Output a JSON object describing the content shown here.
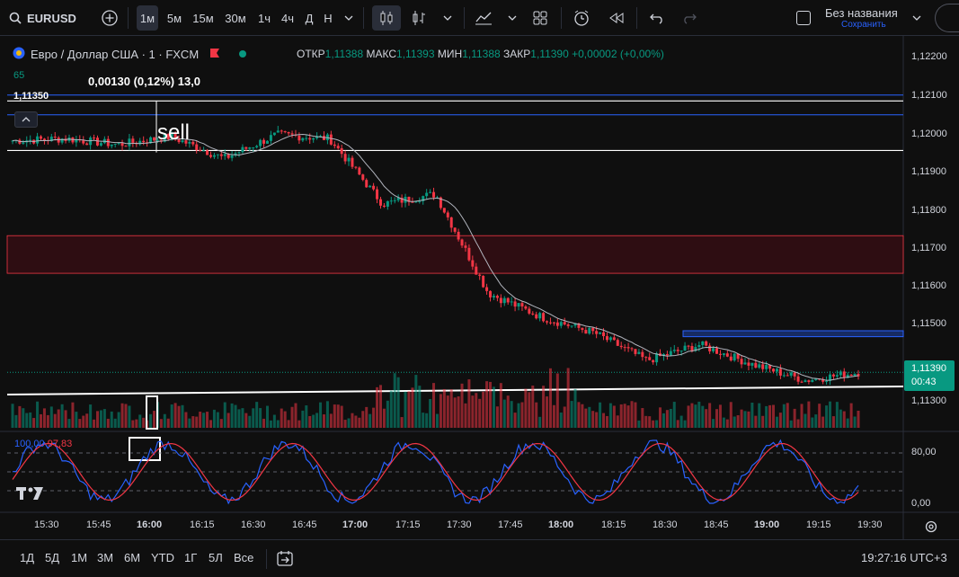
{
  "toolbar": {
    "symbol": "EURUSD",
    "intervals": [
      "1м",
      "5м",
      "15м",
      "30м",
      "1ч",
      "4ч",
      "Д",
      "Н"
    ],
    "active_interval": "1м",
    "layout_name": "Без названия",
    "layout_save": "Сохранить"
  },
  "legend": {
    "title": "Евро / Доллар США · 1 · FXCM",
    "ohlc": [
      {
        "label": "ОТКР",
        "value": "1,11388"
      },
      {
        "label": "МАКС",
        "value": "1,11393"
      },
      {
        "label": "МИН",
        "value": "1,11388"
      },
      {
        "label": "ЗАКР",
        "value": "1,11390"
      }
    ],
    "change": "+0,00002 (+0,00%)",
    "small_value": "65",
    "level_label": "1,11350"
  },
  "annotations": {
    "measure": "0,00130 (0,12%) 13,0",
    "sell_text": "sell"
  },
  "price_axis": {
    "labels": [
      "1,12200",
      "1,12100",
      "1,12000",
      "1,11900",
      "1,11800",
      "1,11700",
      "1,11600",
      "1,11500",
      "1,11300"
    ],
    "current_price": "1,11390",
    "countdown": "00:43",
    "stoch_labels": [
      "80,00",
      "0,00"
    ]
  },
  "time_axis": {
    "labels": [
      "15:30",
      "15:45",
      "16:00",
      "16:15",
      "16:30",
      "16:45",
      "17:00",
      "17:15",
      "17:30",
      "17:45",
      "18:00",
      "18:15",
      "18:30",
      "18:45",
      "19:00",
      "19:15",
      "19:30"
    ]
  },
  "stochastic": {
    "k_value": "100,00",
    "d_value": "97,83"
  },
  "bottombar": {
    "ranges": [
      "1Д",
      "5Д",
      "1М",
      "3М",
      "6М",
      "YTD",
      "1Г",
      "5Л",
      "Все"
    ],
    "clock": "19:27:16 UTC+3"
  },
  "colors": {
    "up": "#089981",
    "down": "#f23645",
    "background": "#0f0f0f",
    "blue_zone": "#2962ff",
    "red_zone": "#f23645"
  },
  "chart_data": {
    "type": "line",
    "x": [
      "15:30",
      "15:45",
      "16:00",
      "16:15",
      "16:30",
      "16:45",
      "17:00",
      "17:15",
      "17:30",
      "17:45",
      "18:00",
      "18:15",
      "18:30",
      "18:45",
      "19:00",
      "19:15",
      "19:27"
    ],
    "series": [
      {
        "values": [
          1.11975,
          1.1198,
          1.11965,
          1.11985,
          1.1193,
          1.1199,
          1.1198,
          1.11815,
          1.1184,
          1.1159,
          1.1153,
          1.1149,
          1.1142,
          1.1146,
          1.1141,
          1.1137,
          1.1139
        ]
      }
    ],
    "ylim": [
      1.1125,
      1.1223
    ]
  }
}
